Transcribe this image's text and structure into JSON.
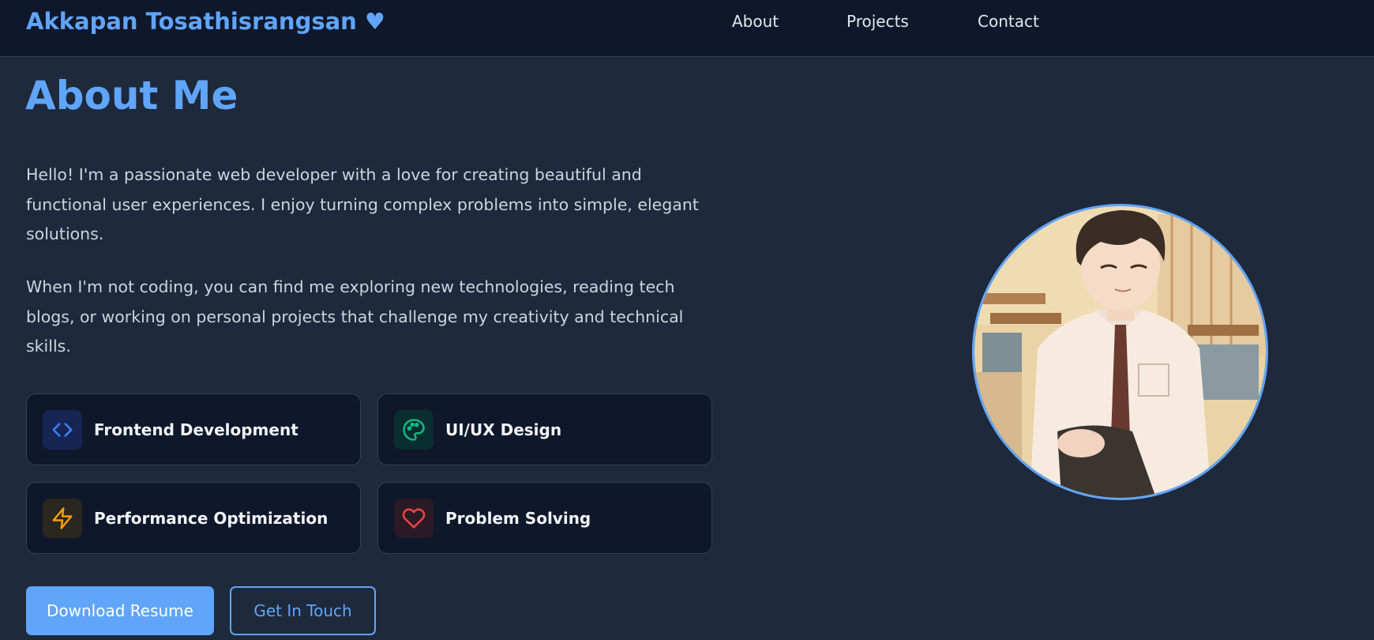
{
  "nav": {
    "brand": "Akkapan Tosathisrangsan ♥",
    "links": [
      "About",
      "Projects",
      "Contact"
    ]
  },
  "about": {
    "title": "About Me",
    "paragraphs": [
      "Hello! I'm a passionate web developer with a love for creating beautiful and functional user experiences. I enjoy turning complex problems into simple, elegant solutions.",
      "When I'm not coding, you can find me exploring new technologies, reading tech blogs, or working on personal projects that challenge my creativity and technical skills."
    ]
  },
  "skills": [
    {
      "label": "Frontend Development",
      "icon": "code-icon",
      "color": "#3b82f6"
    },
    {
      "label": "UI/UX Design",
      "icon": "palette-icon",
      "color": "#10b981"
    },
    {
      "label": "Performance Optimization",
      "icon": "lightning-icon",
      "color": "#f59e0b"
    },
    {
      "label": "Problem Solving",
      "icon": "heart-icon",
      "color": "#ef4444"
    }
  ],
  "buttons": {
    "download": "Download Resume",
    "contact": "Get In Touch"
  },
  "colors": {
    "accent": "#60a5fa",
    "background": "#1e293b",
    "nav_background": "#0f172a",
    "card_background": "#0f172a"
  }
}
